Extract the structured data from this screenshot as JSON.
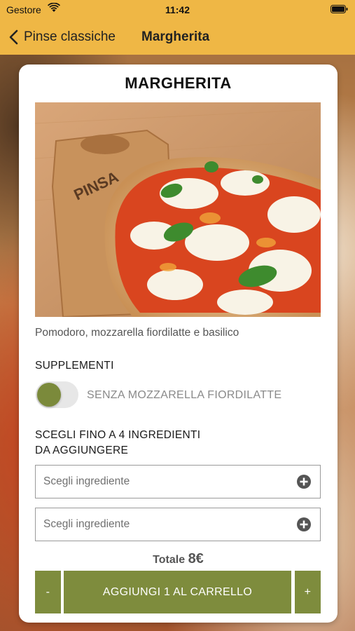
{
  "status_bar": {
    "carrier": "Gestore",
    "time": "11:42"
  },
  "nav": {
    "back_label": "Pinse classiche",
    "title": "Margherita"
  },
  "product": {
    "name": "MARGHERITA",
    "description": "Pomodoro, mozzarella fiordilatte e basilico",
    "board_stamp": "PINSA"
  },
  "supplements": {
    "label": "SUPPLEMENTI",
    "toggle_label": "SENZA MOZZARELLA FIORDILATTE",
    "toggle_on": false
  },
  "ingredients": {
    "label_line1": "SCEGLI FINO A 4 INGREDIENTI",
    "label_line2": "DA AGGIUNGERE",
    "selects": [
      {
        "placeholder": "Scegli ingrediente"
      },
      {
        "placeholder": "Scegli ingrediente"
      }
    ]
  },
  "total": {
    "label": "Totale",
    "price": "8€"
  },
  "actions": {
    "minus": "-",
    "add": "AGGIUNGI 1 AL CARRELLO",
    "plus": "+"
  },
  "colors": {
    "accent_yellow": "#efb745",
    "olive_green": "#7e8c3d"
  }
}
